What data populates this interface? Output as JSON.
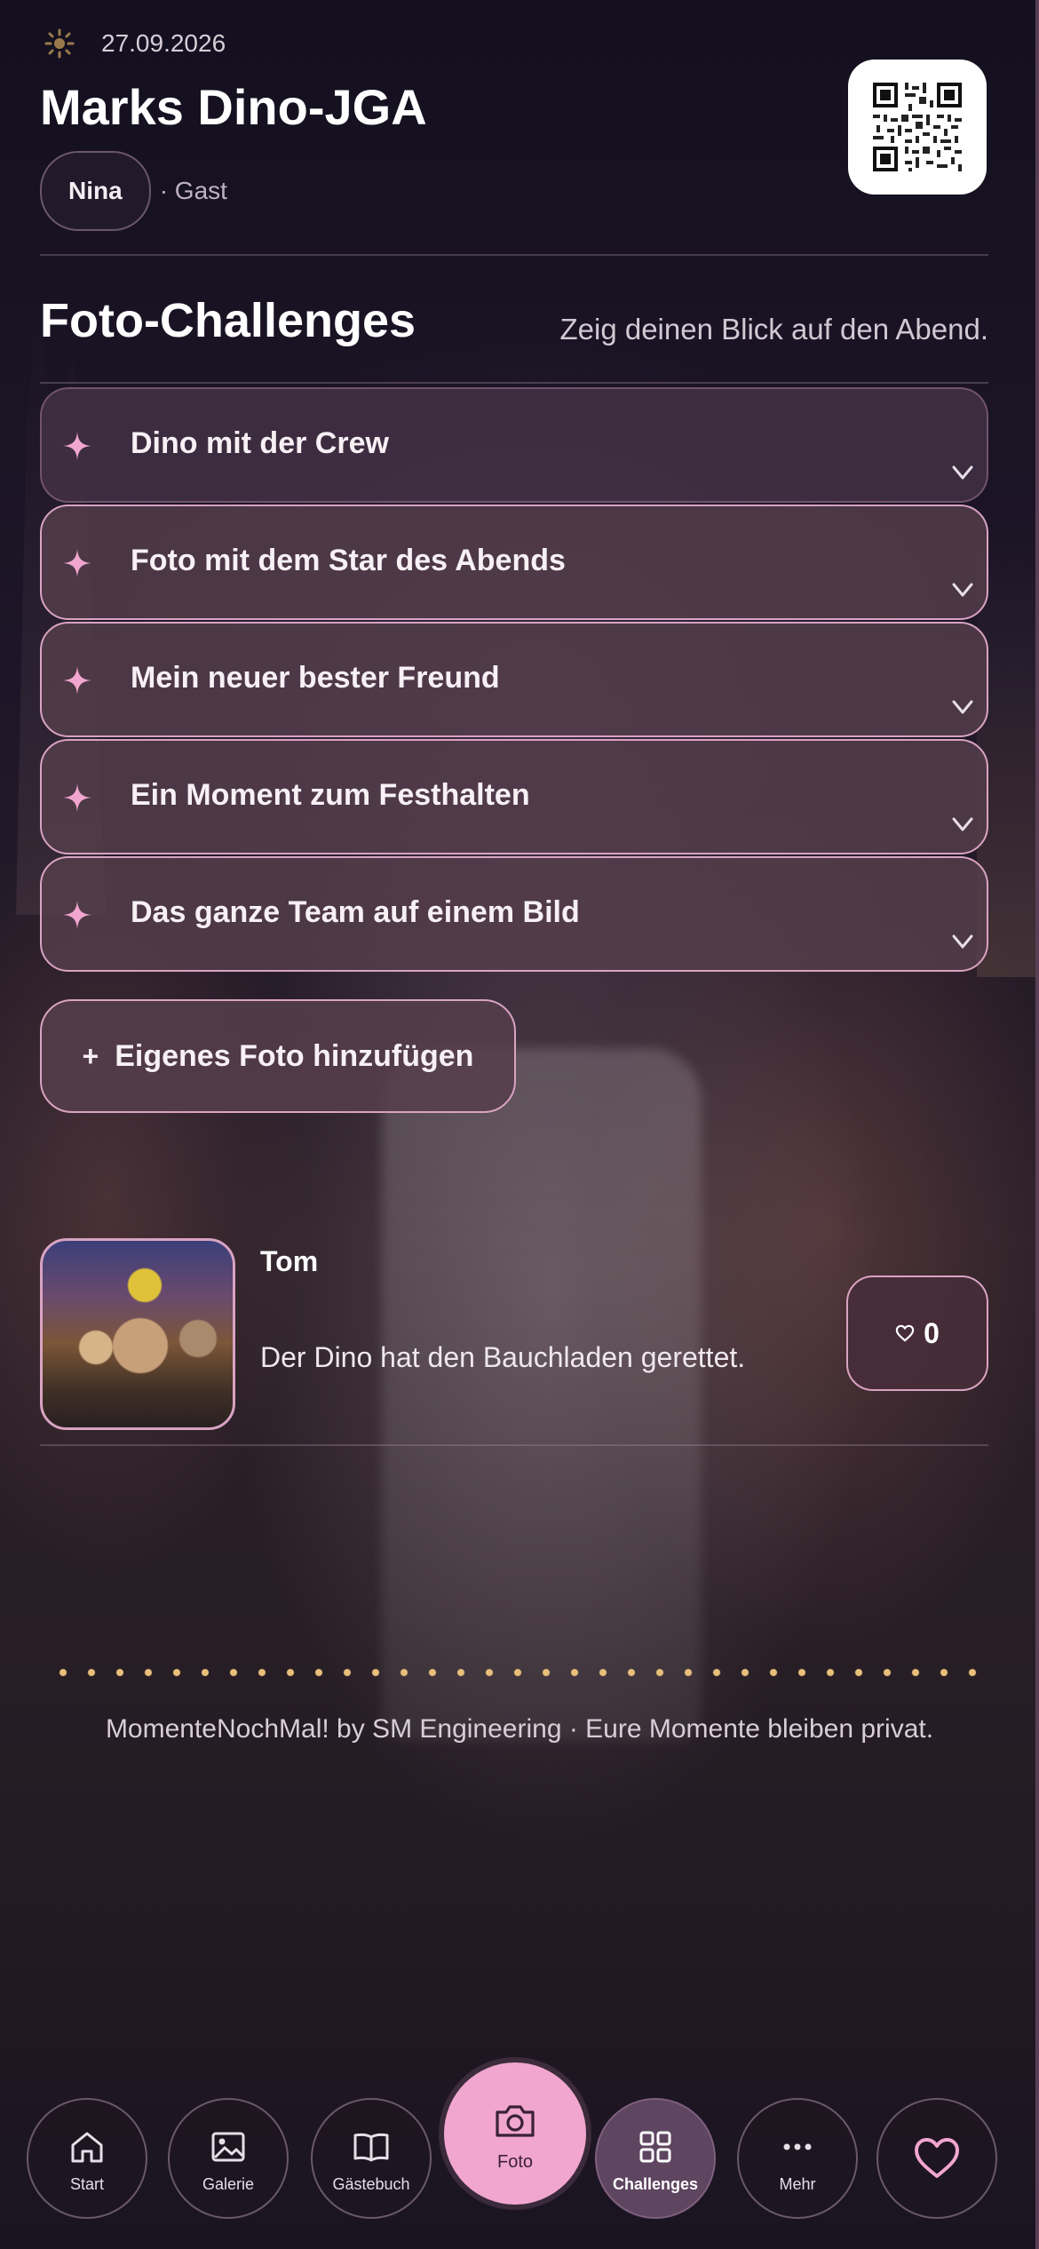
{
  "header": {
    "date": "27.09.2026",
    "event_title": "Marks Dino-JGA",
    "user_name": "Nina",
    "user_role": "· Gast"
  },
  "section": {
    "title": "Foto-Challenges",
    "subtitle": "Zeig deinen Blick auf den Abend."
  },
  "challenges": [
    {
      "label": "Dino mit der Crew"
    },
    {
      "label": "Foto mit dem Star des Abends"
    },
    {
      "label": "Mein neuer bester Freund"
    },
    {
      "label": "Ein Moment zum Festhalten"
    },
    {
      "label": "Das ganze Team auf einem Bild"
    }
  ],
  "add_button": {
    "plus": "+",
    "label": "Eigenes Foto hinzufügen"
  },
  "entry": {
    "author": "Tom",
    "caption": "Der Dino hat den Bauchladen gerettet.",
    "likes": "0",
    "like_icon": "heart-outline-icon"
  },
  "footer": {
    "text": "MomenteNochMal! by SM Engineering · Eure Momente bleiben privat."
  },
  "nav": {
    "items": [
      {
        "label": "Start",
        "icon": "home-icon"
      },
      {
        "label": "Galerie",
        "icon": "image-icon"
      },
      {
        "label": "Gästebuch",
        "icon": "book-icon"
      },
      {
        "label": "Foto",
        "icon": "camera-icon"
      },
      {
        "label": "Challenges",
        "icon": "grid-icon"
      },
      {
        "label": "Mehr",
        "icon": "more-icon"
      },
      {
        "label": "",
        "icon": "heart-icon"
      }
    ],
    "active": "Challenges"
  },
  "colors": {
    "accent": "#f1a6cf",
    "card_border": "#d9a3c2",
    "card_bg": "#563e4c",
    "dots": "#e8c07a"
  }
}
